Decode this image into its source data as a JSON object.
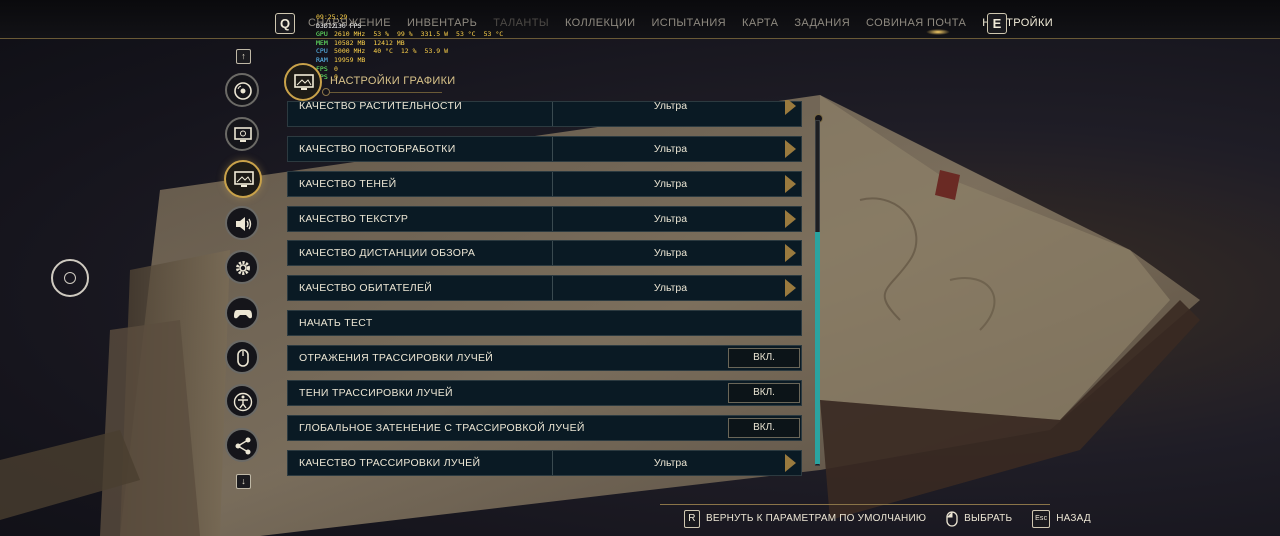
{
  "nav": {
    "left_key": "Q",
    "right_key": "E",
    "items": [
      {
        "label": "СНАРЯЖЕНИЕ"
      },
      {
        "label": "ИНВЕНТАРЬ"
      },
      {
        "label": "ТАЛАНТЫ"
      },
      {
        "label": "КОЛЛЕКЦИИ"
      },
      {
        "label": "ИСПЫТАНИЯ"
      },
      {
        "label": "КАРТА"
      },
      {
        "label": "ЗАДАНИЯ"
      },
      {
        "label": "СОВИНАЯ ПОЧТА"
      },
      {
        "label": "НАСТРОЙКИ"
      }
    ]
  },
  "perf": {
    "time": "09:25:29",
    "rows": [
      {
        "label": "D3D12",
        "values": [
          "130 FPS"
        ]
      },
      {
        "label": "GPU",
        "values": [
          "2610 MHz",
          "53 %",
          "99 %",
          "331.5 W",
          "53 °C",
          "53 °C"
        ]
      },
      {
        "label": "MEM",
        "values": [
          "10582 MB",
          "12412 MB"
        ]
      },
      {
        "label": "CPU",
        "values": [
          "5000 MHz",
          "40 °C",
          "12 %",
          "53.9 W"
        ]
      },
      {
        "label": "RAM",
        "values": [
          "19959 MB"
        ]
      },
      {
        "label": "FPS",
        "values": [
          "0"
        ]
      },
      {
        "label": "FPS",
        "values": [
          "0"
        ]
      }
    ]
  },
  "sidebar": {
    "up_key": "↑",
    "down_key": "↓",
    "categories": [
      {
        "icon": "disc-icon"
      },
      {
        "icon": "monitor-icon"
      },
      {
        "icon": "graphics-icon"
      },
      {
        "icon": "speaker-icon"
      },
      {
        "icon": "gear-icon"
      },
      {
        "icon": "gamepad-icon"
      },
      {
        "icon": "mouse-icon"
      },
      {
        "icon": "accessibility-icon"
      },
      {
        "icon": "network-icon"
      }
    ]
  },
  "section": {
    "title": "НАСТРОЙКИ ГРАФИКИ"
  },
  "settings": [
    {
      "label": "КАЧЕСТВО РАСТИТЕЛЬНОСТИ",
      "kind": "select",
      "value": "Ультра"
    },
    {
      "label": "КАЧЕСТВО ПОСТОБРАБОТКИ",
      "kind": "select",
      "value": "Ультра"
    },
    {
      "label": "КАЧЕСТВО ТЕНЕЙ",
      "kind": "select",
      "value": "Ультра"
    },
    {
      "label": "КАЧЕСТВО ТЕКСТУР",
      "kind": "select",
      "value": "Ультра"
    },
    {
      "label": "КАЧЕСТВО ДИСТАНЦИИ ОБЗОРА",
      "kind": "select",
      "value": "Ультра"
    },
    {
      "label": "КАЧЕСТВО ОБИТАТЕЛЕЙ",
      "kind": "select",
      "value": "Ультра"
    },
    {
      "label": "НАЧАТЬ ТЕСТ",
      "kind": "action",
      "value": ""
    },
    {
      "label": "ОТРАЖЕНИЯ ТРАССИРОВКИ ЛУЧЕЙ",
      "kind": "toggle",
      "value": "ВКЛ."
    },
    {
      "label": "ТЕНИ ТРАССИРОВКИ ЛУЧЕЙ",
      "kind": "toggle",
      "value": "ВКЛ."
    },
    {
      "label": "ГЛОБАЛЬНОЕ ЗАТЕНЕНИЕ С ТРАССИРОВКОЙ ЛУЧЕЙ",
      "kind": "toggle",
      "value": "ВКЛ."
    },
    {
      "label": "КАЧЕСТВО ТРАССИРОВКИ ЛУЧЕЙ",
      "kind": "select",
      "value": "Ультра"
    }
  ],
  "footer": {
    "reset_key": "R",
    "reset_label": "ВЕРНУТЬ К ПАРАМЕТРАМ ПО УМОЛЧАНИЮ",
    "select_label": "ВЫБРАТЬ",
    "back_key": "Esc",
    "back_label": "НАЗАД"
  },
  "colors": {
    "accent_gold": "#c9a24a",
    "row_bg": "#0a1a24",
    "scroll_thumb": "#2aa3a0",
    "active_nav": "#f2ecd8",
    "dim_nav": "#4d4a46"
  }
}
